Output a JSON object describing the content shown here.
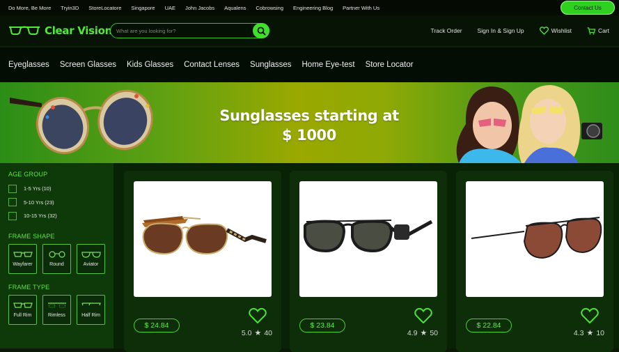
{
  "topbar": {
    "links": [
      "Do More, Be More",
      "Tryin3D",
      "StoreLocatore",
      "Singapore",
      "UAE",
      "John Jacobs",
      "Aqualens",
      "Cobrowsing",
      "Engineering Blog",
      "Partner With Us"
    ],
    "contact_label": "Contact Us"
  },
  "header": {
    "brand": "Clear Vision",
    "search_placeholder": "What are you looking for?",
    "track_order": "Track Order",
    "sign_in": "Sign In & Sign Up",
    "wishlist": "Wishlist",
    "cart": "Cart"
  },
  "nav": {
    "items": [
      "Eyeglasses",
      "Screen Glasses",
      "Kids Glasses",
      "Contact Lenses",
      "Sunglasses",
      "Home Eye-test",
      "Store Locator"
    ]
  },
  "banner": {
    "line1": "Sunglasses starting at",
    "line2": "$ 1000"
  },
  "filters": {
    "age_group": {
      "title": "AGE GROUP",
      "options": [
        "1-5  Yrs (10)",
        "5-10  Yrs (23)",
        "10-15  Yrs (32)"
      ]
    },
    "frame_shape": {
      "title": "FRAME SHAPE",
      "options": [
        "Wayfarer",
        "Round",
        "Aviator"
      ]
    },
    "frame_type": {
      "title": "FRAME TYPE",
      "options": [
        "Full Rim",
        "Rimless",
        "Half Rim"
      ]
    }
  },
  "products": [
    {
      "price": "$ 24.84",
      "rating": "5.0",
      "reviews": "40"
    },
    {
      "price": "$ 23.84",
      "rating": "4.9",
      "reviews": "50"
    },
    {
      "price": "$ 22.84",
      "rating": "4.3",
      "reviews": "10"
    }
  ],
  "colors": {
    "accent": "#3ee02a",
    "background": "#0a1a06",
    "sidebar": "#0e3a0a"
  }
}
